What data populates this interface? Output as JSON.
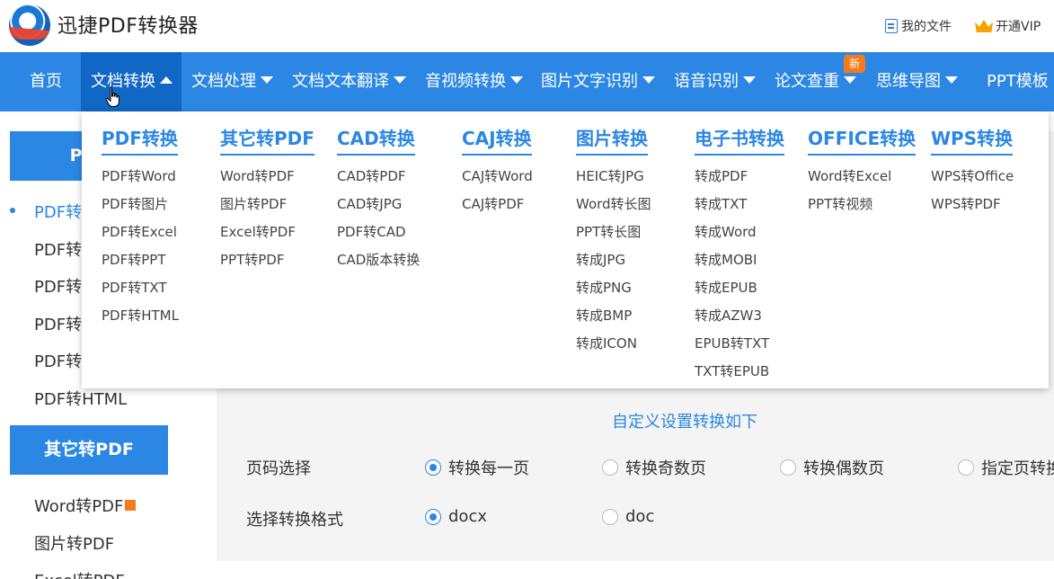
{
  "header": {
    "app_title": "迅捷PDF转换器",
    "my_files": "我的文件",
    "vip": "开通VIP"
  },
  "nav": {
    "items": [
      "首页",
      "文档转换",
      "文档处理",
      "文档文本翻译",
      "音视频转换",
      "图片文字识别",
      "语音识别",
      "论文查重",
      "思维导图",
      "PPT模板"
    ],
    "active_index": 1,
    "new_badge": "新"
  },
  "sidebar": {
    "group1_head": "PDF",
    "group1_items": [
      "PDF转",
      "PDF转",
      "PDF转",
      "PDF转",
      "PDF转",
      "PDF转HTML"
    ],
    "group2_head": "其它转PDF",
    "group2_items": [
      "Word转PDF",
      "图片转PDF",
      "Excel转PDF"
    ]
  },
  "dropdown": {
    "columns": [
      {
        "head": "PDF转换",
        "items": [
          "PDF转Word",
          "PDF转图片",
          "PDF转Excel",
          "PDF转PPT",
          "PDF转TXT",
          "PDF转HTML"
        ]
      },
      {
        "head": "其它转PDF",
        "items": [
          "Word转PDF",
          "图片转PDF",
          "Excel转PDF",
          "PPT转PDF"
        ]
      },
      {
        "head": "CAD转换",
        "items": [
          "CAD转PDF",
          "CAD转JPG",
          "PDF转CAD",
          "CAD版本转换"
        ]
      },
      {
        "head": "CAJ转换",
        "items": [
          "CAJ转Word",
          "CAJ转PDF"
        ]
      },
      {
        "head": "图片转换",
        "items": [
          "HEIC转JPG",
          "Word转长图",
          "PPT转长图",
          "转成JPG",
          "转成PNG",
          "转成BMP",
          "转成ICON"
        ]
      },
      {
        "head": "电子书转换",
        "items": [
          "转成PDF",
          "转成TXT",
          "转成Word",
          "转成MOBI",
          "转成EPUB",
          "转成AZW3",
          "EPUB转TXT",
          "TXT转EPUB"
        ]
      },
      {
        "head": "OFFICE转换",
        "items": [
          "Word转Excel",
          "PPT转视频"
        ]
      },
      {
        "head": "WPS转换",
        "items": [
          "WPS转Office",
          "WPS转PDF"
        ]
      }
    ]
  },
  "settings": {
    "title": "自定义设置转换如下",
    "page_label": "页码选择",
    "page_options": [
      "转换每一页",
      "转换奇数页",
      "转换偶数页",
      "指定页转换"
    ],
    "page_selected": 0,
    "format_label": "选择转换格式",
    "format_options": [
      "docx",
      "doc"
    ],
    "format_selected": 0
  }
}
